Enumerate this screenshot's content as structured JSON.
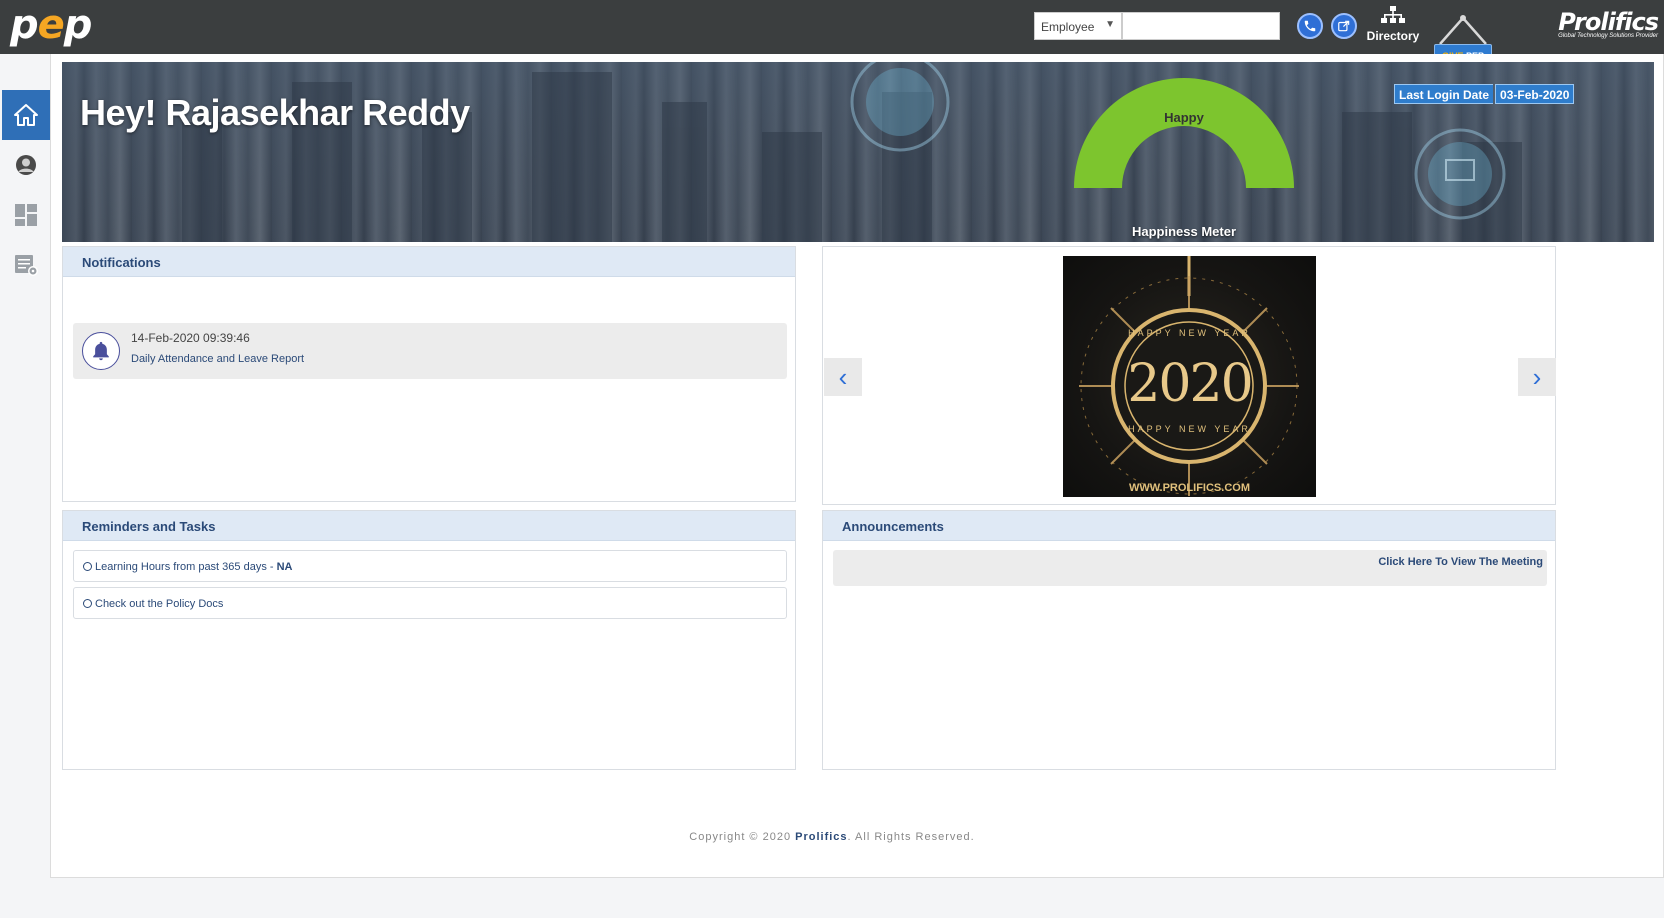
{
  "header": {
    "logo_p1": "p",
    "logo_e": "e",
    "logo_p2": "p",
    "employee_select": "Employee",
    "search_value": "",
    "directory_label": "Directory",
    "give_pep_1": "GIVE",
    "give_pep_2": "PEP",
    "brand_name": "Prolifics",
    "brand_tagline": "Global Technology Solutions Provider",
    "icons": [
      "phone-icon",
      "share-icon",
      "org-chart-icon"
    ]
  },
  "sidebar": {
    "items": [
      {
        "icon": "home-icon",
        "active": true
      },
      {
        "icon": "user-avatar-icon",
        "active": false
      },
      {
        "icon": "dashboard-icon",
        "active": false
      },
      {
        "icon": "report-settings-icon",
        "active": false
      }
    ]
  },
  "banner": {
    "greeting": "Hey! Rajasekhar Reddy",
    "mood": "Happy",
    "meter_title": "Happiness Meter",
    "meter_color": "#7dc52e",
    "last_login_label": "Last Login Date",
    "last_login_value": "03-Feb-2020"
  },
  "notifications": {
    "title": "Notifications",
    "items": [
      {
        "time": "14-Feb-2020 09:39:46",
        "text": "Daily Attendance and Leave Report"
      }
    ]
  },
  "reminders": {
    "title": "Reminders and Tasks",
    "items": [
      {
        "text": "Learning Hours from past 365 days - ",
        "value": "NA"
      },
      {
        "text": "Check out the Policy Docs",
        "value": ""
      }
    ]
  },
  "carousel": {
    "prev": "‹",
    "next": "›",
    "image_year": "2020",
    "image_caption_top": "HAPPY NEW YEAR",
    "image_caption_bottom": "HAPPY NEW YEAR",
    "image_url_text": "WWW.PROLIFICS.COM"
  },
  "announcements": {
    "title": "Announcements",
    "link": "Click Here To View The Meeting"
  },
  "footer": {
    "prefix": "Copyright © 2020 ",
    "company": "Prolifics",
    "suffix": ". All Rights Reserved."
  }
}
